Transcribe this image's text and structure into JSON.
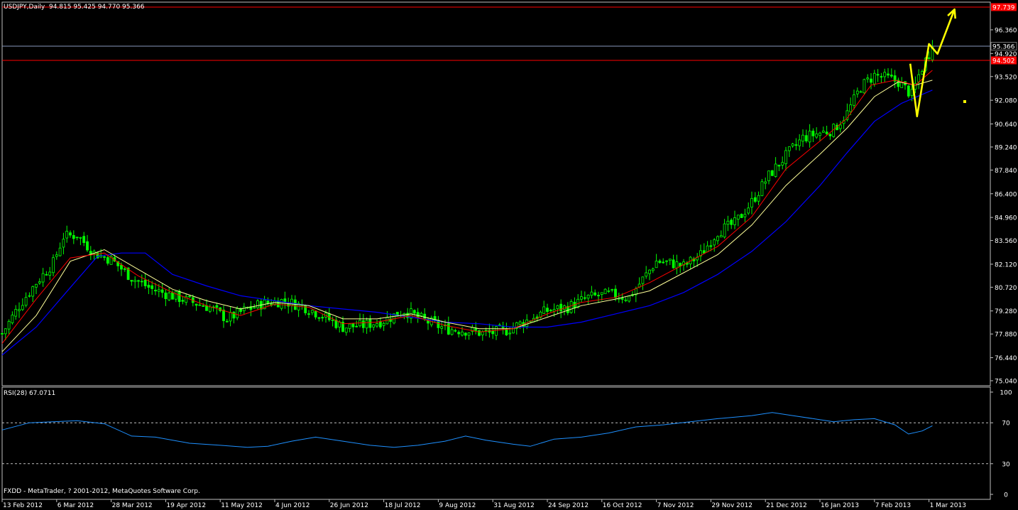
{
  "header": {
    "symbol_timeframe": "USDJPY,Daily",
    "ohlc": "94.815 95.425 94.770 95.366"
  },
  "rsi": {
    "label": "RSI(28) 67.0711",
    "axis_ticks": [
      "100",
      "70",
      "30",
      "0"
    ]
  },
  "footer": {
    "copyright": "FXDD - MetaTrader, ? 2001-2012, MetaQuotes Software Corp."
  },
  "colors": {
    "background": "#000000",
    "bull_candle": "#00ff00",
    "bear_candle": "#00ff00",
    "ma_fast": "#ff0000",
    "ma_mid": "#ffff99",
    "ma_slow": "#0000ff",
    "resistance_line": "#ff0000",
    "current_price_line": "#8899bb",
    "projection_arrow": "#ffff00",
    "rsi_line": "#1e90ff"
  },
  "chart_data": {
    "type": "candlestick",
    "symbol": "USDJPY",
    "timeframe": "Daily",
    "y_range": [
      75.04,
      97.739
    ],
    "y_tick_labels": [
      "97.739",
      "96.360",
      "95.366",
      "94.920",
      "94.502",
      "93.520",
      "92.080",
      "90.640",
      "89.240",
      "87.840",
      "86.400",
      "84.960",
      "83.560",
      "82.120",
      "80.720",
      "79.280",
      "77.880",
      "76.440",
      "75.040"
    ],
    "y_ticks_plain": [
      96.36,
      94.92,
      93.52,
      92.08,
      90.64,
      89.24,
      87.84,
      86.4,
      84.96,
      83.56,
      82.12,
      80.72,
      79.28,
      77.88,
      76.44,
      75.04
    ],
    "x_tick_labels": [
      "13 Feb 2012",
      "6 Mar 2012",
      "28 Mar 2012",
      "19 Apr 2012",
      "11 May 2012",
      "4 Jun 2012",
      "26 Jun 2012",
      "18 Jul 2012",
      "9 Aug 2012",
      "31 Aug 2012",
      "24 Sep 2012",
      "16 Oct 2012",
      "7 Nov 2012",
      "29 Nov 2012",
      "21 Dec 2012",
      "16 Jan 2013",
      "7 Feb 2013",
      "1 Mar 2013"
    ],
    "horizontal_lines": [
      {
        "price": 97.739,
        "color": "#ff0000",
        "label": "97.739"
      },
      {
        "price": 95.366,
        "color": "#8899bb",
        "label": "95.366"
      },
      {
        "price": 94.502,
        "color": "#ff0000",
        "label": "94.502"
      }
    ],
    "close_path": [
      [
        0,
        77.9
      ],
      [
        5,
        79.6
      ],
      [
        10,
        81.0
      ],
      [
        15,
        82.2
      ],
      [
        18,
        83.8
      ],
      [
        22,
        83.9
      ],
      [
        27,
        82.8
      ],
      [
        32,
        82.4
      ],
      [
        38,
        81.3
      ],
      [
        44,
        80.6
      ],
      [
        50,
        80.2
      ],
      [
        56,
        79.8
      ],
      [
        61,
        79.5
      ],
      [
        66,
        78.8
      ],
      [
        71,
        79.3
      ],
      [
        76,
        79.7
      ],
      [
        82,
        79.9
      ],
      [
        88,
        79.6
      ],
      [
        94,
        79.0
      ],
      [
        100,
        78.3
      ],
      [
        106,
        78.4
      ],
      [
        112,
        78.7
      ],
      [
        118,
        79.3
      ],
      [
        124,
        78.7
      ],
      [
        130,
        78.2
      ],
      [
        136,
        78.1
      ],
      [
        142,
        77.9
      ],
      [
        148,
        78.1
      ],
      [
        154,
        78.7
      ],
      [
        160,
        79.3
      ],
      [
        166,
        79.5
      ],
      [
        172,
        80.1
      ],
      [
        178,
        80.3
      ],
      [
        184,
        80.1
      ],
      [
        188,
        81.2
      ],
      [
        192,
        82.3
      ],
      [
        196,
        82.2
      ],
      [
        200,
        82.0
      ],
      [
        205,
        82.7
      ],
      [
        210,
        84.1
      ],
      [
        215,
        84.6
      ],
      [
        220,
        85.9
      ],
      [
        225,
        87.5
      ],
      [
        230,
        88.7
      ],
      [
        235,
        89.8
      ],
      [
        240,
        90.1
      ],
      [
        244,
        90.3
      ],
      [
        248,
        91.3
      ],
      [
        252,
        92.9
      ],
      [
        256,
        93.6
      ],
      [
        260,
        93.4
      ],
      [
        263,
        93.2
      ],
      [
        265,
        92.8
      ],
      [
        267,
        92.4
      ],
      [
        269,
        93.6
      ],
      [
        271,
        94.5
      ],
      [
        273,
        95.366
      ]
    ],
    "ma_fast_path": [
      [
        0,
        77.3
      ],
      [
        10,
        80.0
      ],
      [
        20,
        82.5
      ],
      [
        30,
        82.8
      ],
      [
        40,
        81.4
      ],
      [
        50,
        80.4
      ],
      [
        60,
        79.6
      ],
      [
        70,
        79.0
      ],
      [
        80,
        79.7
      ],
      [
        90,
        79.5
      ],
      [
        100,
        78.5
      ],
      [
        110,
        78.6
      ],
      [
        120,
        79.0
      ],
      [
        130,
        78.4
      ],
      [
        140,
        78.0
      ],
      [
        150,
        78.2
      ],
      [
        160,
        79.1
      ],
      [
        170,
        79.8
      ],
      [
        180,
        80.1
      ],
      [
        190,
        81.0
      ],
      [
        200,
        82.1
      ],
      [
        210,
        83.2
      ],
      [
        220,
        85.0
      ],
      [
        230,
        87.9
      ],
      [
        240,
        89.6
      ],
      [
        248,
        91.0
      ],
      [
        255,
        93.0
      ],
      [
        262,
        93.3
      ],
      [
        268,
        93.0
      ],
      [
        273,
        93.9
      ]
    ],
    "ma_mid_path": [
      [
        0,
        76.8
      ],
      [
        10,
        79.0
      ],
      [
        20,
        82.3
      ],
      [
        30,
        83.0
      ],
      [
        40,
        81.8
      ],
      [
        50,
        80.6
      ],
      [
        60,
        79.9
      ],
      [
        70,
        79.4
      ],
      [
        80,
        79.8
      ],
      [
        90,
        79.6
      ],
      [
        100,
        78.8
      ],
      [
        110,
        78.8
      ],
      [
        120,
        79.1
      ],
      [
        130,
        78.6
      ],
      [
        140,
        78.2
      ],
      [
        150,
        78.2
      ],
      [
        160,
        78.9
      ],
      [
        170,
        79.6
      ],
      [
        180,
        80.0
      ],
      [
        190,
        80.5
      ],
      [
        200,
        81.6
      ],
      [
        210,
        82.7
      ],
      [
        220,
        84.5
      ],
      [
        230,
        86.9
      ],
      [
        240,
        88.8
      ],
      [
        248,
        90.4
      ],
      [
        256,
        92.3
      ],
      [
        263,
        93.2
      ],
      [
        268,
        93.0
      ],
      [
        273,
        93.3
      ]
    ],
    "ma_slow_path": [
      [
        0,
        76.6
      ],
      [
        10,
        78.3
      ],
      [
        20,
        80.7
      ],
      [
        28,
        82.6
      ],
      [
        35,
        82.8
      ],
      [
        42,
        82.8
      ],
      [
        50,
        81.5
      ],
      [
        60,
        80.8
      ],
      [
        70,
        80.2
      ],
      [
        80,
        79.9
      ],
      [
        90,
        79.6
      ],
      [
        100,
        79.4
      ],
      [
        110,
        79.2
      ],
      [
        120,
        78.9
      ],
      [
        130,
        78.6
      ],
      [
        140,
        78.5
      ],
      [
        150,
        78.3
      ],
      [
        160,
        78.3
      ],
      [
        170,
        78.6
      ],
      [
        180,
        79.1
      ],
      [
        190,
        79.6
      ],
      [
        200,
        80.4
      ],
      [
        210,
        81.5
      ],
      [
        220,
        82.9
      ],
      [
        230,
        84.7
      ],
      [
        240,
        86.9
      ],
      [
        248,
        88.9
      ],
      [
        256,
        90.8
      ],
      [
        264,
        91.9
      ],
      [
        273,
        92.7
      ]
    ],
    "projection_path": [
      [
        266.5,
        94.3
      ],
      [
        268.5,
        91.1
      ],
      [
        272,
        95.5
      ],
      [
        274.5,
        94.9
      ],
      [
        279.5,
        97.6
      ]
    ],
    "projection_dot": [
      282.5,
      92.0
    ],
    "rsi_range": [
      0,
      100
    ],
    "rsi_levels": [
      70,
      30
    ],
    "rsi_path": [
      [
        0,
        63
      ],
      [
        8,
        70
      ],
      [
        15,
        71
      ],
      [
        22,
        72
      ],
      [
        30,
        69
      ],
      [
        38,
        57
      ],
      [
        45,
        56
      ],
      [
        55,
        50
      ],
      [
        64,
        48
      ],
      [
        72,
        46
      ],
      [
        78,
        47
      ],
      [
        85,
        52
      ],
      [
        92,
        56
      ],
      [
        100,
        52
      ],
      [
        108,
        48
      ],
      [
        115,
        46
      ],
      [
        122,
        48
      ],
      [
        130,
        52
      ],
      [
        136,
        57
      ],
      [
        142,
        53
      ],
      [
        150,
        49
      ],
      [
        155,
        47
      ],
      [
        162,
        54
      ],
      [
        170,
        56
      ],
      [
        178,
        60
      ],
      [
        186,
        66
      ],
      [
        194,
        68
      ],
      [
        202,
        71
      ],
      [
        210,
        74
      ],
      [
        220,
        77
      ],
      [
        226,
        80
      ],
      [
        232,
        77
      ],
      [
        238,
        74
      ],
      [
        244,
        71
      ],
      [
        250,
        73
      ],
      [
        256,
        74
      ],
      [
        262,
        68
      ],
      [
        266,
        59
      ],
      [
        270,
        62
      ],
      [
        273,
        67.07
      ]
    ]
  }
}
